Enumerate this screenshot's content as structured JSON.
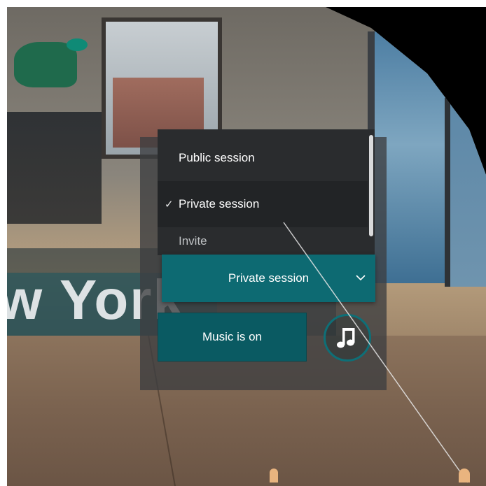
{
  "environment": {
    "banner_text": "w York"
  },
  "session_menu": {
    "options": [
      {
        "label": "Public session",
        "selected": false
      },
      {
        "label": "Private session",
        "selected": true
      },
      {
        "label": "Invite",
        "selected": false
      }
    ],
    "check_glyph": "✓",
    "selected_value": "Private session"
  },
  "music": {
    "button_label": "Music is on",
    "icon": "music-note-icon"
  },
  "colors": {
    "accent": "#0d6a72",
    "panel": "#3c3e40",
    "dropdown": "#2a2c2e"
  }
}
